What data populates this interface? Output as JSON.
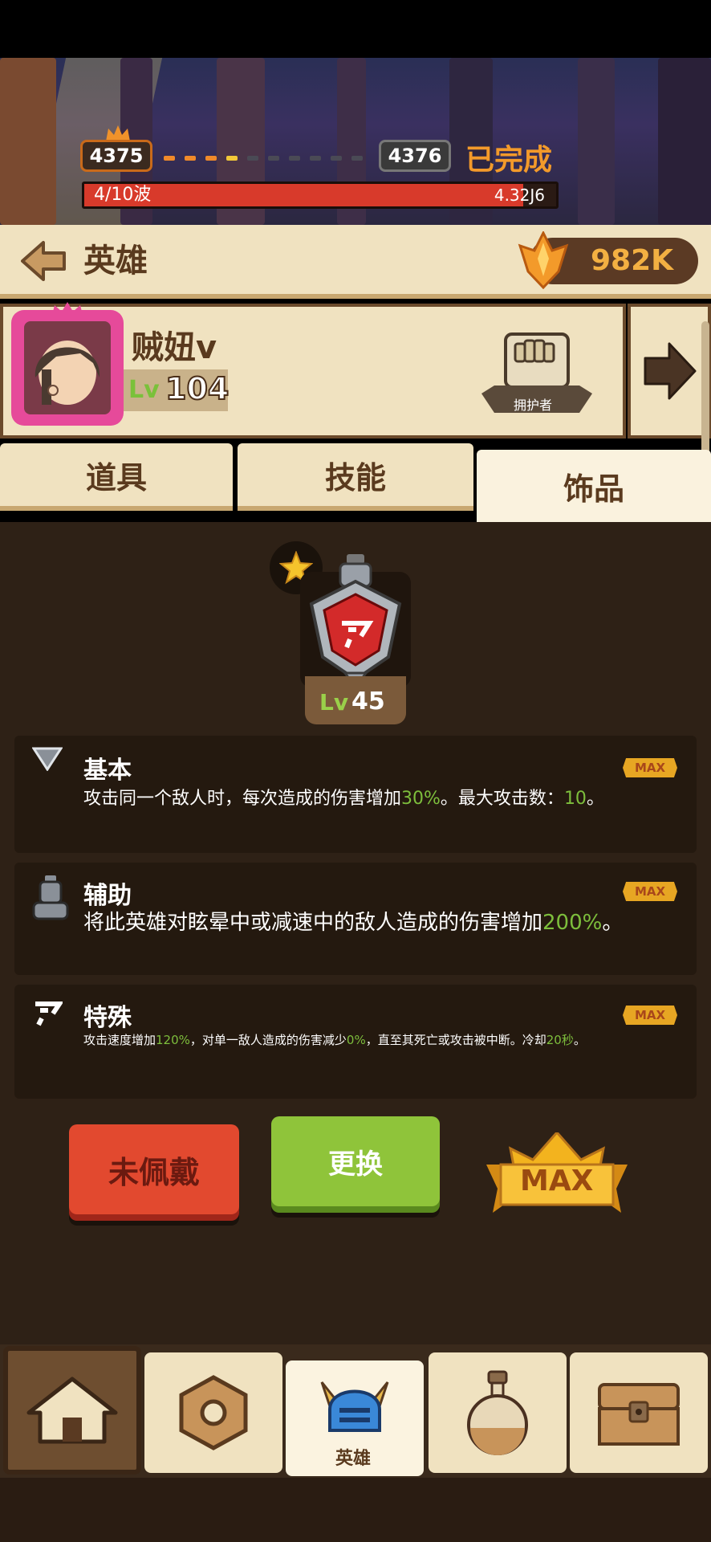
{
  "battle": {
    "current_stage": "4375",
    "next_stage": "4376",
    "status": "已完成",
    "wave_text": "4/10波",
    "wave_progress": 0.93,
    "damage_value": "4.32J6"
  },
  "header": {
    "title": "英雄",
    "currency_value": "982K"
  },
  "hero": {
    "name": "贼妞v",
    "lv_label": "Lv",
    "level": "104",
    "role": "拥护者"
  },
  "tabs": [
    {
      "label": "道具"
    },
    {
      "label": "技能"
    },
    {
      "label": "饰品"
    }
  ],
  "item": {
    "lv_label": "Lv",
    "level": "45"
  },
  "stats": [
    {
      "title": "基本",
      "desc_a": "攻击同一个敌人时，每次造成的伤害增加",
      "hl_1": "30%",
      "desc_b": "。最大攻击数：",
      "hl_2": "10",
      "desc_c": "。",
      "badge": "MAX"
    },
    {
      "title": "辅助",
      "desc_a": "将此英雄对眩晕中或减速中的敌人造成的伤害增加",
      "hl_1": "200%",
      "desc_b": "。",
      "badge": "MAX"
    },
    {
      "title": "特殊",
      "desc_a": "攻击速度增加",
      "hl_1": "120%",
      "desc_b": "，对单一敌人造成的伤害减少",
      "hl_2": "0%",
      "desc_c": "，直至其死亡或攻击被中断。冷却",
      "hl_3": "20秒",
      "desc_d": "。",
      "badge": "MAX"
    }
  ],
  "actions": {
    "unequip": "未佩戴",
    "change": "更换",
    "max": "MAX"
  },
  "nav": {
    "hero_label": "英雄"
  }
}
